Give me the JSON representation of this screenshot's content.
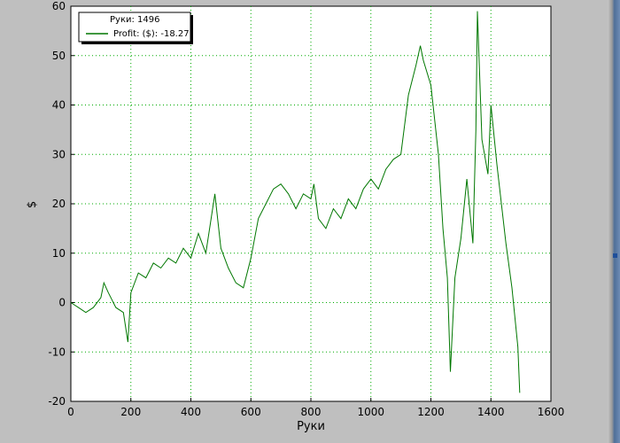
{
  "chart_data": {
    "type": "line",
    "title": "",
    "xlabel": "Руки",
    "ylabel": "$",
    "xlim": [
      0,
      1600
    ],
    "ylim": [
      -20,
      60
    ],
    "xticks": [
      0,
      200,
      400,
      600,
      800,
      1000,
      1200,
      1400,
      1600
    ],
    "yticks": [
      -20,
      -10,
      0,
      10,
      20,
      30,
      40,
      50,
      60
    ],
    "grid": true,
    "grid_style": "dotted",
    "legend_position": "top-left",
    "legend_title": "Руки: 1496",
    "series": [
      {
        "name": "Profit: ($): -18.27",
        "color": "#007700",
        "x": [
          0,
          25,
          50,
          75,
          100,
          110,
          125,
          150,
          175,
          190,
          200,
          225,
          250,
          275,
          300,
          325,
          350,
          375,
          400,
          425,
          450,
          470,
          480,
          500,
          525,
          550,
          575,
          600,
          625,
          650,
          675,
          700,
          725,
          750,
          775,
          800,
          810,
          825,
          850,
          875,
          900,
          925,
          950,
          975,
          1000,
          1025,
          1050,
          1075,
          1100,
          1125,
          1150,
          1165,
          1175,
          1200,
          1225,
          1240,
          1255,
          1265,
          1280,
          1300,
          1320,
          1340,
          1350,
          1355,
          1370,
          1390,
          1400,
          1420,
          1450,
          1470,
          1490,
          1496
        ],
        "values": [
          0,
          -1,
          -2,
          -1,
          1,
          4,
          2,
          -1,
          -2,
          -8,
          2,
          6,
          5,
          8,
          7,
          9,
          8,
          11,
          9,
          14,
          10,
          18,
          22,
          11,
          7,
          4,
          3,
          9,
          17,
          20,
          23,
          24,
          22,
          19,
          22,
          21,
          24,
          17,
          15,
          19,
          17,
          21,
          19,
          23,
          25,
          23,
          27,
          29,
          30,
          42,
          48,
          52,
          49,
          44,
          30,
          15,
          5,
          -14,
          5,
          13,
          25,
          12,
          35,
          59,
          33,
          26,
          40,
          28,
          12,
          3,
          -9,
          -18.27
        ]
      }
    ]
  }
}
